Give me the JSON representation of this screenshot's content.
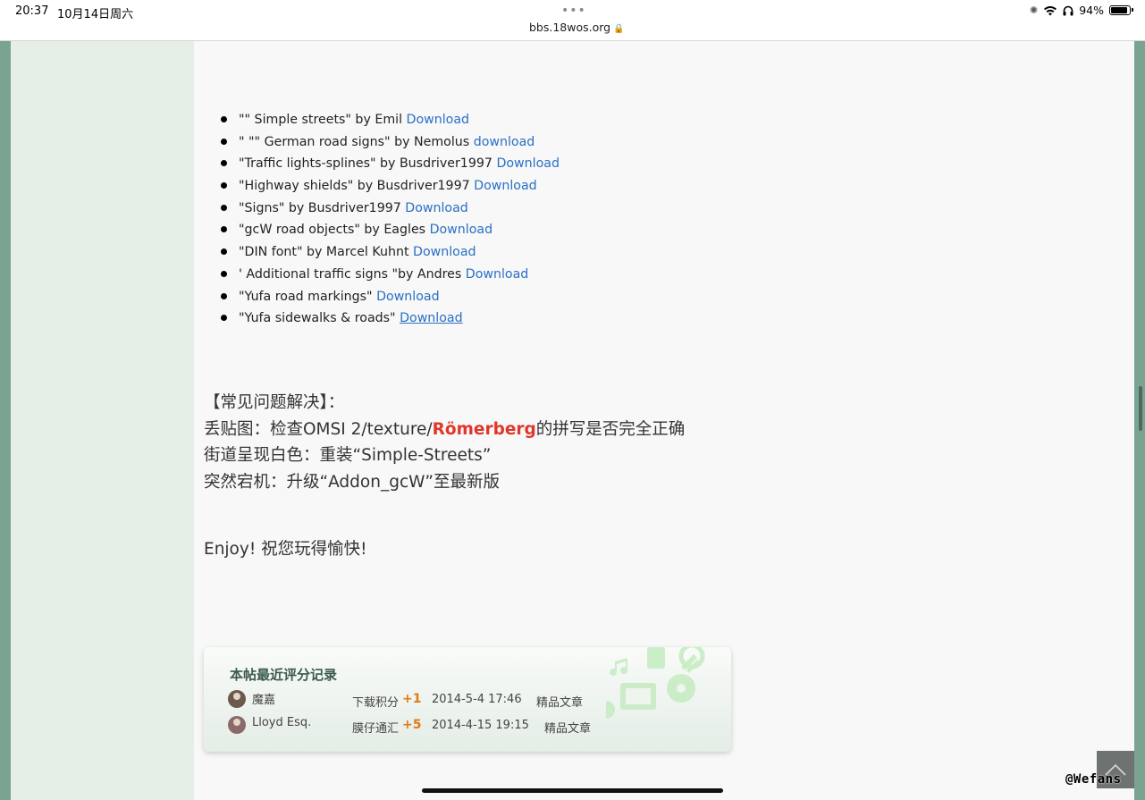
{
  "statusbar": {
    "time": "20:37",
    "date": "10月14日周六",
    "dots": "•••",
    "url": "bbs.18wos.org",
    "battery": "94%",
    "battery_level": 0.94
  },
  "downloads": [
    {
      "text": "\"\" Simple streets\" by Emil ",
      "link": "Download"
    },
    {
      "text": "\" \"\" German road signs\" by Nemolus ",
      "link": "download"
    },
    {
      "text": "\"Traffic lights-splines\" by Busdriver1997 ",
      "link": "Download"
    },
    {
      "text": "\"Highway shields\" by Busdriver1997 ",
      "link": "Download"
    },
    {
      "text": "\"Signs\" by Busdriver1997 ",
      "link": "Download"
    },
    {
      "text": "\"gcW road objects\" by Eagles ",
      "link": "Download"
    },
    {
      "text": "\"DIN font\" by Marcel Kuhnt ",
      "link": "Download"
    },
    {
      "text": "' Additional traffic signs \"by Andres ",
      "link": "Download"
    },
    {
      "text": "\"Yufa road markings\" ",
      "link": "Download"
    },
    {
      "text": "\"Yufa sidewalks & roads\" ",
      "link": "Download"
    }
  ],
  "faq": {
    "heading": "【常见问题解决】：",
    "line1_prefix": "丢贴图：检查OMSI 2/texture/",
    "line1_highlight": "Römerberg",
    "line1_suffix": "的拼写是否完全正确",
    "line2": "街道呈现白色：重装“Simple-Streets”",
    "line3": "突然宕机：升级“Addon_gcW”至最新版"
  },
  "enjoy": "Enjoy! 祝您玩得愉快!",
  "ratings": {
    "title": "本帖最近评分记录",
    "rows": [
      {
        "user": "魔嘉",
        "category": "下载积分",
        "score": "+1",
        "time": "2014-5-4 17:46",
        "reason": "精品文章"
      },
      {
        "user": "Lloyd Esq.",
        "category": "膜仔通汇",
        "score": "+5",
        "time": "2014-4-15 19:15",
        "reason": "精品文章"
      }
    ]
  },
  "watermark": "@Wefans"
}
